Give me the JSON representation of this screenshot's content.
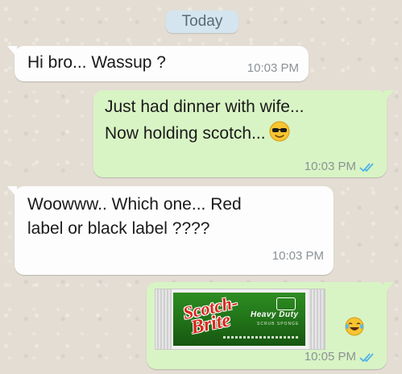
{
  "chat": {
    "date_label": "Today",
    "messages": [
      {
        "direction": "incoming",
        "lines": [
          "Hi bro... Wassup ?"
        ],
        "time": "10:03 PM"
      },
      {
        "direction": "outgoing",
        "lines": [
          "Just had dinner with wife...",
          "Now holding scotch..."
        ],
        "emoji": "sunglasses-face",
        "time": "10:03 PM",
        "status": "read"
      },
      {
        "direction": "incoming",
        "lines": [
          "Woowww.. Which one... Red",
          "label or black label ????"
        ],
        "time": "10:03 PM"
      },
      {
        "direction": "outgoing",
        "image": {
          "brand": "Scotch-Brite",
          "brand_line1": "Scotch-",
          "brand_line2": "Brite",
          "variant": "Heavy Duty",
          "subtext": "SCRUB SPONGE"
        },
        "emoji": "tears-of-joy-face",
        "time": "10:05 PM",
        "status": "read"
      }
    ]
  },
  "colors": {
    "incoming_bubble": "#fdfdfd",
    "outgoing_bubble": "#d8f4c4",
    "read_ticks": "#4fb3e8",
    "date_pill": "#d5e5ef",
    "wallpaper": "#e3ddd3"
  }
}
